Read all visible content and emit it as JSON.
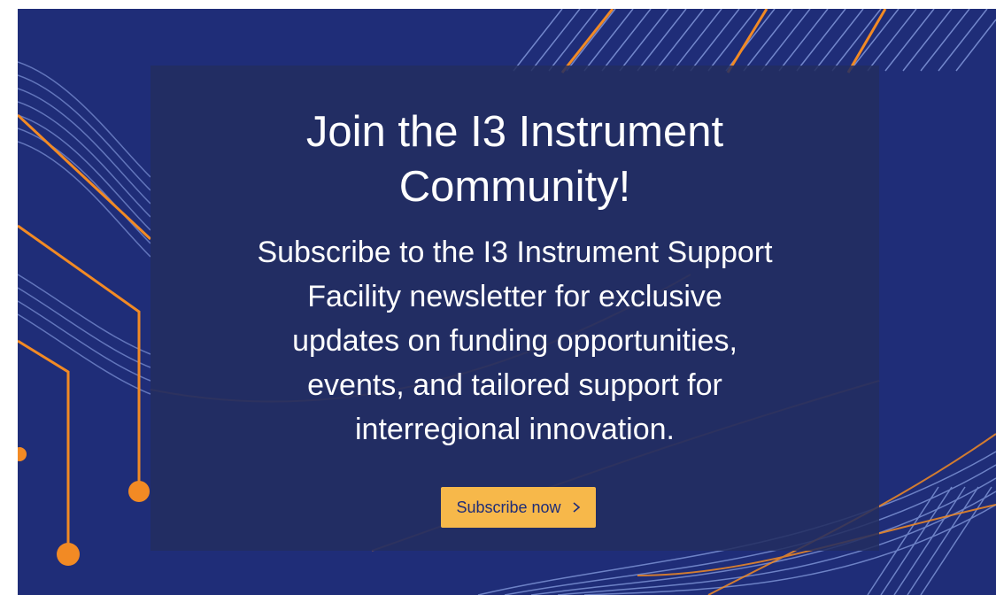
{
  "banner": {
    "headline_lines": [
      "Join the I3 Instrument",
      "Community!"
    ],
    "body_lines": [
      "Subscribe to the I3 Instrument Support",
      "Facility newsletter for exclusive",
      "updates on funding opportunities,",
      "events, and tailored support for",
      "interregional innovation."
    ],
    "cta": {
      "label": "Subscribe now",
      "icon": "chevron-right-icon"
    }
  },
  "colors": {
    "background": "#1f2d78",
    "panel": "#232d5f",
    "accent": "#f7b84a",
    "line_orange": "#f28a24",
    "line_light": "#8fa6e8",
    "text": "#ffffff"
  }
}
